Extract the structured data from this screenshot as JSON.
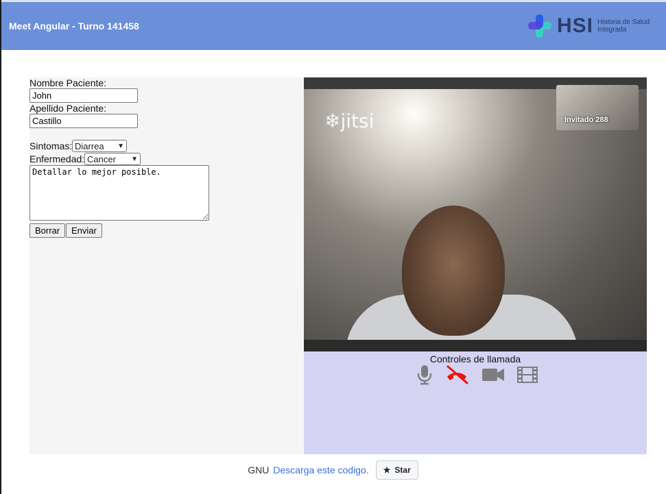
{
  "header": {
    "title": "Meet Angular - Turno 141458",
    "logo_text": "HSI",
    "logo_subtitle": "Historia de Salud Integrada",
    "logo_colors": [
      "#2b5be8",
      "#36d3c3"
    ]
  },
  "form": {
    "first_name_label": "Nombre Paciente:",
    "first_name_value": "John",
    "last_name_label": "Apellido Paciente:",
    "last_name_value": "Castillo",
    "symptoms_label": "Sintomas:",
    "symptoms_value": "Diarrea",
    "disease_label": "Enfermedad:",
    "disease_value": "Cancer",
    "notes_value": "Detallar lo mejor posible.",
    "clear_button": "Borrar",
    "send_button": "Enviar"
  },
  "video": {
    "watermark": "jitsi",
    "participant_name": "Invitado 288"
  },
  "controls": {
    "title": "Controles de llamada",
    "icons": [
      "microphone-icon",
      "hangup-phone-icon",
      "video-camera-icon",
      "film-icon"
    ],
    "hangup_color": "#ee1111",
    "icon_color": "#7d7d7d"
  },
  "footer": {
    "license_text": "GNU",
    "download_link": "Descarga este codigo.",
    "star_button": "Star"
  }
}
